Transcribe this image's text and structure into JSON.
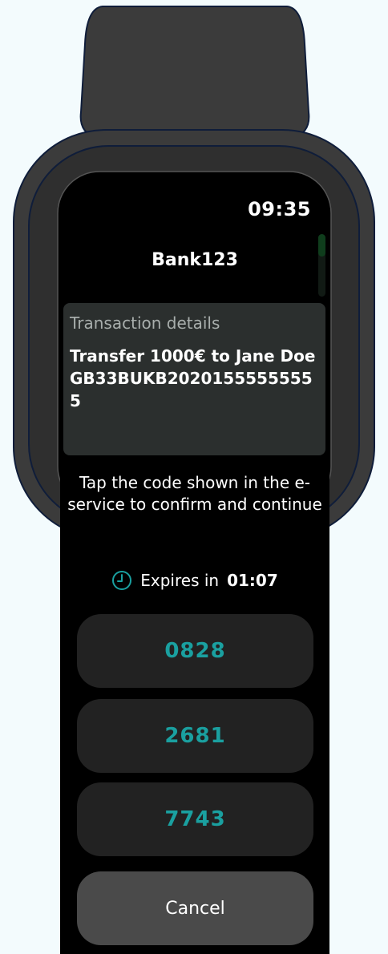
{
  "status_bar": {
    "time": "09:35"
  },
  "app": {
    "title": "Bank123"
  },
  "transaction": {
    "label": "Transaction details",
    "details": "Transfer 1000€ to Jane Doe GB33BUKB20201555555555"
  },
  "instructions": "Tap the code shown in the e-service to confirm and continue",
  "expiry": {
    "icon": "clock-icon",
    "label": "Expires in",
    "value": "01:07"
  },
  "codes": [
    "0828",
    "2681",
    "7743"
  ],
  "cancel_label": "Cancel",
  "colors": {
    "page_background": "#f3fbfd",
    "watch_body": "#3a3a3a",
    "watch_outline": "#0f1d3a",
    "screen": "#000000",
    "card": "#2b2f2e",
    "code_button": "#222222",
    "code_text": "#1aa0a0",
    "cancel_button": "#4a4a4a"
  }
}
